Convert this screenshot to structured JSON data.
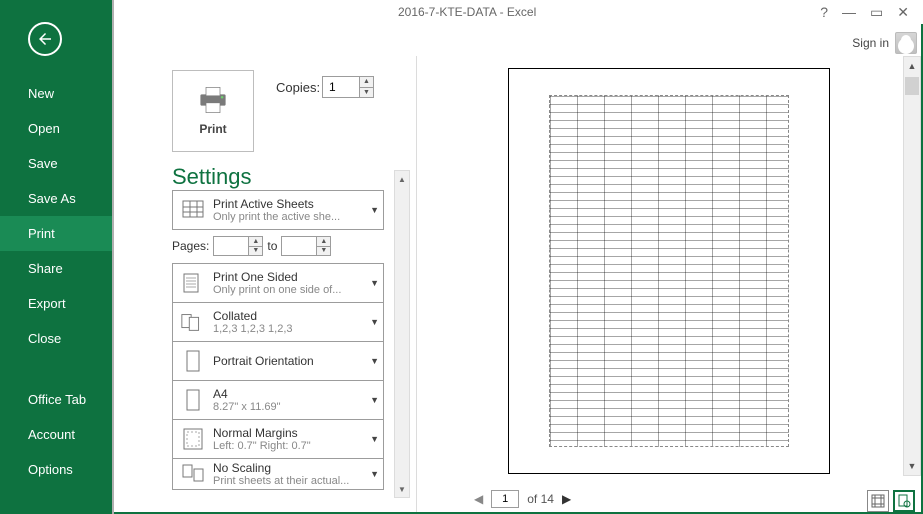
{
  "titlebar": {
    "title": "2016-7-KTE-DATA - Excel",
    "help": "?",
    "min": "—",
    "max": "▭",
    "close": "✕"
  },
  "signin": {
    "label": "Sign in"
  },
  "sidebar": {
    "items": [
      {
        "label": "New"
      },
      {
        "label": "Open"
      },
      {
        "label": "Save"
      },
      {
        "label": "Save As"
      },
      {
        "label": "Print"
      },
      {
        "label": "Share"
      },
      {
        "label": "Export"
      },
      {
        "label": "Close"
      }
    ],
    "items2": [
      {
        "label": "Office Tab"
      },
      {
        "label": "Account"
      },
      {
        "label": "Options"
      }
    ]
  },
  "print": {
    "button_label": "Print",
    "copies_label": "Copies:",
    "copies_value": "1"
  },
  "settings": {
    "header": "Settings",
    "pages_label": "Pages:",
    "pages_to": "to",
    "options": [
      {
        "id": "active-sheets",
        "line1": "Print Active Sheets",
        "line2": "Only print the active she..."
      },
      {
        "id": "one-sided",
        "line1": "Print One Sided",
        "line2": "Only print on one side of..."
      },
      {
        "id": "collated",
        "line1": "Collated",
        "line2": "1,2,3    1,2,3    1,2,3"
      },
      {
        "id": "portrait",
        "line1": "Portrait Orientation",
        "line2": ""
      },
      {
        "id": "a4",
        "line1": "A4",
        "line2": "8.27\" x 11.69\""
      },
      {
        "id": "margins",
        "line1": "Normal Margins",
        "line2": "Left:  0.7\"    Right:  0.7\""
      },
      {
        "id": "scaling",
        "line1": "No Scaling",
        "line2": "Print sheets at their actual..."
      }
    ]
  },
  "pager": {
    "current": "1",
    "of_label": "of 14"
  }
}
